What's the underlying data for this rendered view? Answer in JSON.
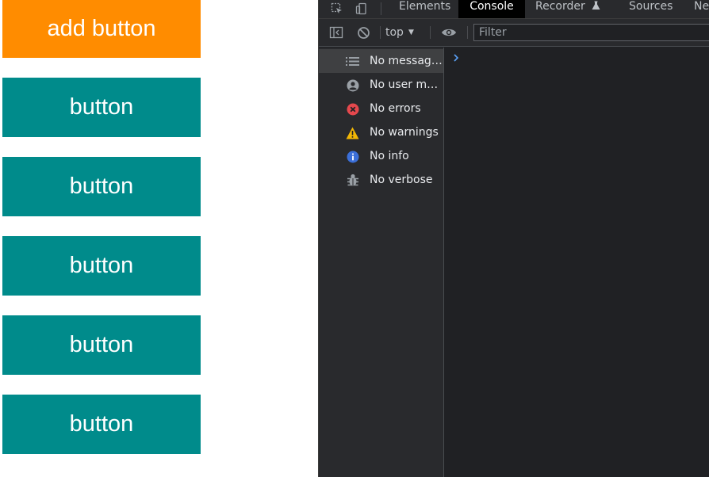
{
  "page": {
    "add_button_label": "add button",
    "add_button_color": "#ff8c00",
    "button_color": "#008b8b",
    "buttons": [
      {
        "label": "button"
      },
      {
        "label": "button"
      },
      {
        "label": "button"
      },
      {
        "label": "button"
      },
      {
        "label": "button"
      }
    ]
  },
  "devtools": {
    "tabs": [
      {
        "label": "Elements",
        "active": false
      },
      {
        "label": "Console",
        "active": true
      },
      {
        "label": "Recorder",
        "active": false,
        "icon": "flask-icon"
      },
      {
        "label": "Sources",
        "active": false
      },
      {
        "label": "Ne",
        "active": false
      }
    ],
    "toolbar": {
      "context_label": "top",
      "filter_placeholder": "Filter"
    },
    "sidebar": {
      "items": [
        {
          "label": "No messages",
          "icon": "list-icon",
          "selected": true
        },
        {
          "label": "No user me...",
          "icon": "user-icon",
          "selected": false
        },
        {
          "label": "No errors",
          "icon": "error-icon",
          "selected": false,
          "color": "#e5484d"
        },
        {
          "label": "No warnings",
          "icon": "warning-icon",
          "selected": false,
          "color": "#f2b705"
        },
        {
          "label": "No info",
          "icon": "info-icon",
          "selected": false,
          "color": "#3b6fd8"
        },
        {
          "label": "No verbose",
          "icon": "bug-icon",
          "selected": false
        }
      ]
    }
  }
}
